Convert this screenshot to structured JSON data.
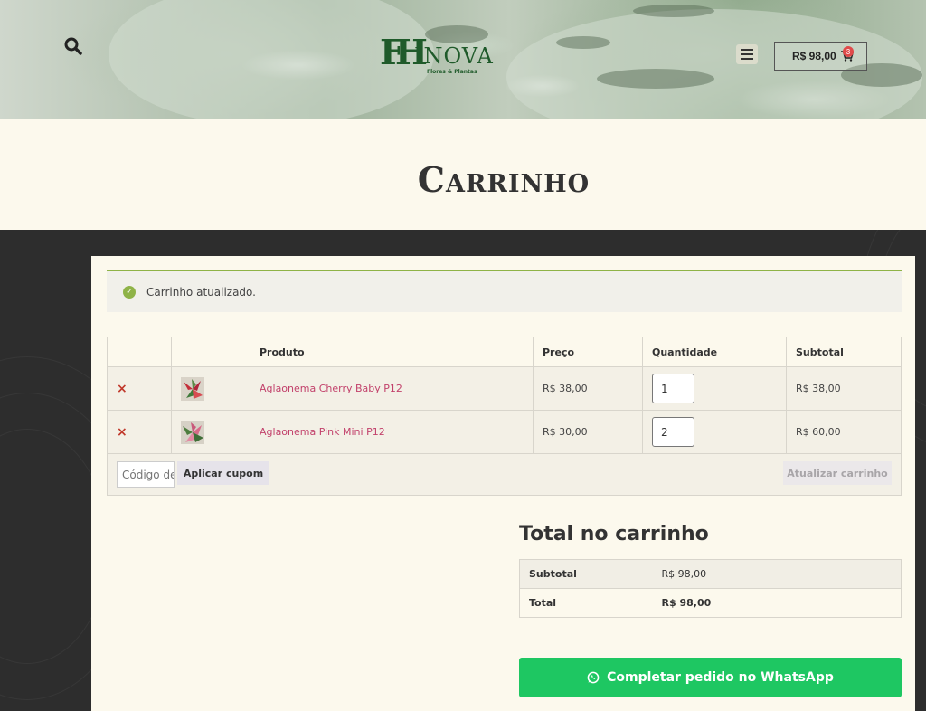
{
  "header": {
    "logo": {
      "mark": "FH",
      "name": "INOVA",
      "tagline": "Flores & Plantas"
    },
    "cart": {
      "total": "R$ 98,00",
      "count": "3"
    }
  },
  "page": {
    "title": "Carrinho"
  },
  "notice": {
    "message": "Carrinho atualizado."
  },
  "cart_table": {
    "headers": [
      "",
      "",
      "Produto",
      "Preço",
      "Quantidade",
      "Subtotal"
    ],
    "rows": [
      {
        "name": "Aglaonema Cherry Baby P12",
        "price": "R$ 38,00",
        "quantity": "1",
        "subtotal": "R$ 38,00"
      },
      {
        "name": "Aglaonema Pink Mini P12",
        "price": "R$ 30,00",
        "quantity": "2",
        "subtotal": "R$ 60,00"
      }
    ],
    "remove_symbol": "×"
  },
  "actions": {
    "coupon_placeholder": "Código de cupom",
    "apply_coupon": "Aplicar cupom",
    "update_cart": "Atualizar carrinho"
  },
  "totals": {
    "title": "Total no carrinho",
    "subtotal_label": "Subtotal",
    "subtotal_value": "R$ 98,00",
    "total_label": "Total",
    "total_value": "R$ 98,00"
  },
  "checkout": {
    "whatsapp_label": "Completar pedido no WhatsApp"
  },
  "colors": {
    "accent": "#8fb347",
    "link": "#c2416b",
    "whatsapp": "#1ec762",
    "cream": "#fcf9ed"
  }
}
